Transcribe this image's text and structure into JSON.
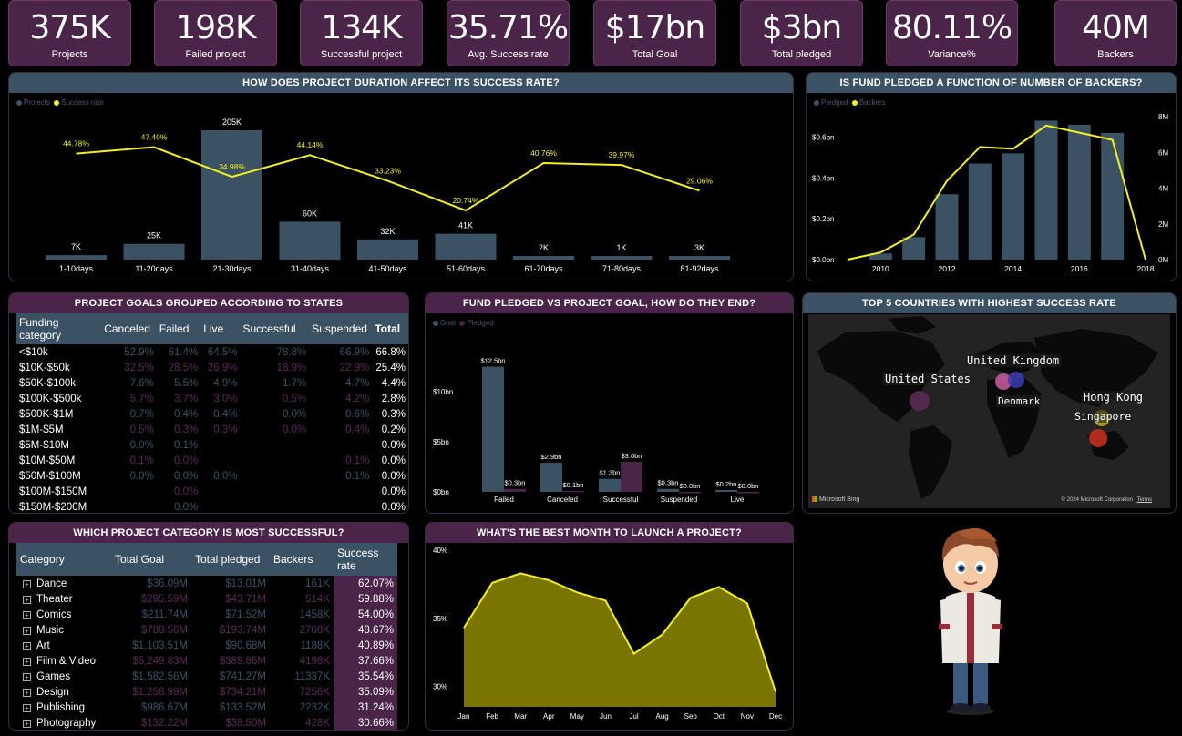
{
  "kpis": [
    {
      "value": "375K",
      "label": "Projects"
    },
    {
      "value": "198K",
      "label": "Failed project"
    },
    {
      "value": "134K",
      "label": "Successful project"
    },
    {
      "value": "35.71%",
      "label": "Avg. Success rate"
    },
    {
      "value": "$17bn",
      "label": "Total Goal"
    },
    {
      "value": "$3bn",
      "label": "Total pledged"
    },
    {
      "value": "80.11%",
      "label": "Variance%"
    },
    {
      "value": "40M",
      "label": "Backers"
    }
  ],
  "colors": {
    "bar": "#3b5265",
    "line": "#f2f01e",
    "panel_purple": "#4a2549",
    "accent_pink": "#c05a9a"
  },
  "duration": {
    "title": "HOW DOES PROJECT DURATION AFFECT ITS SUCCESS RATE?",
    "legend": [
      "Projects",
      "Success rate"
    ]
  },
  "pledged_backers": {
    "title": "IS FUND PLEDGED A FUNCTION OF NUMBER OF BACKERS?",
    "legend": [
      "Pledged",
      "Backers"
    ],
    "left_ticks": [
      "$0.0bn",
      "$0.2bn",
      "$0.4bn",
      "$0.6bn"
    ],
    "right_ticks": [
      "0M",
      "2M",
      "4M",
      "6M",
      "8M"
    ],
    "x_ticks": [
      "2010",
      "2012",
      "2014",
      "2016",
      "2018"
    ]
  },
  "goals_states": {
    "title": "PROJECT GOALS GROUPED ACCORDING TO STATES",
    "headers": [
      "Funding category",
      "Canceled",
      "Failed",
      "Live",
      "Successful",
      "Suspended",
      "Total"
    ],
    "rows": [
      [
        "<$10k",
        "52.9%",
        "61.4%",
        "64.5%",
        "78.8%",
        "66.9%",
        "66.8%"
      ],
      [
        "$10K-$50k",
        "32.5%",
        "28.5%",
        "26.9%",
        "18.9%",
        "22.9%",
        "25.4%"
      ],
      [
        "$50K-$100k",
        "7.6%",
        "5.5%",
        "4.9%",
        "1.7%",
        "4.7%",
        "4.4%"
      ],
      [
        "$100K-$500k",
        "5.7%",
        "3.7%",
        "3.0%",
        "0.5%",
        "4.2%",
        "2.8%"
      ],
      [
        "$500K-$1M",
        "0.7%",
        "0.4%",
        "0.4%",
        "0.0%",
        "0.6%",
        "0.3%"
      ],
      [
        "$1M-$5M",
        "0.5%",
        "0.3%",
        "0.3%",
        "0.0%",
        "0.4%",
        "0.2%"
      ],
      [
        "$5M-$10M",
        "0.0%",
        "0.1%",
        "",
        "",
        "",
        "0.0%"
      ],
      [
        "$10M-$50M",
        "0.1%",
        "0.0%",
        "",
        "",
        "0.1%",
        "0.0%"
      ],
      [
        "$50M-$100M",
        "0.0%",
        "0.0%",
        "0.0%",
        "",
        "0.1%",
        "0.0%"
      ],
      [
        "$100M-$150M",
        "",
        "0.0%",
        "",
        "",
        "",
        "0.0%"
      ],
      [
        "$150M-$200M",
        "",
        "0.0%",
        "",
        "",
        "",
        "0.0%"
      ]
    ]
  },
  "fund_vs_goal": {
    "title": "FUND PLEDGED VS PROJECT GOAL, HOW DO THEY END?",
    "legend": [
      "Goal",
      "Pledged"
    ],
    "y_ticks": [
      "$0bn",
      "$5bn",
      "$10bn"
    ]
  },
  "top_countries": {
    "title": "TOP 5 COUNTRIES WITH HIGHEST SUCCESS RATE",
    "labels": [
      "United Kingdom",
      "United States",
      "Denmark",
      "Hong Kong",
      "Singapore"
    ],
    "brand": "Microsoft Bing",
    "copyright": "© 2024 Microsoft Corporation",
    "terms": "Terms"
  },
  "category": {
    "title": "WHICH PROJECT CATEGORY IS MOST SUCCESSFUL?",
    "headers": [
      "Category",
      "Total Goal",
      "Total pledged",
      "Backers",
      "Success rate"
    ],
    "rows": [
      [
        "Dance",
        "$36.09M",
        "$13.01M",
        "161K",
        "62.07%"
      ],
      [
        "Theater",
        "$295.59M",
        "$43.71M",
        "514K",
        "59.88%"
      ],
      [
        "Comics",
        "$211.74M",
        "$71.52M",
        "1458K",
        "54.00%"
      ],
      [
        "Music",
        "$788.56M",
        "$193.74M",
        "2708K",
        "48.67%"
      ],
      [
        "Art",
        "$1,103.51M",
        "$90.68M",
        "1188K",
        "40.89%"
      ],
      [
        "Film & Video",
        "$5,249.83M",
        "$389.86M",
        "4198K",
        "37.66%"
      ],
      [
        "Games",
        "$1,582.56M",
        "$741.27M",
        "11337K",
        "35.54%"
      ],
      [
        "Design",
        "$1,258.99M",
        "$734.21M",
        "7256K",
        "35.09%"
      ],
      [
        "Publishing",
        "$986.67M",
        "$133.52M",
        "2232K",
        "31.24%"
      ],
      [
        "Photography",
        "$132.22M",
        "$38.50M",
        "428K",
        "30.66%"
      ]
    ]
  },
  "month": {
    "title": "WHAT'S THE BEST MONTH TO LAUNCH A PROJECT?",
    "y_ticks": [
      "30%",
      "35%",
      "40%"
    ]
  },
  "chart_data": [
    {
      "type": "bar",
      "title": "HOW DOES PROJECT DURATION AFFECT ITS SUCCESS RATE?",
      "categories": [
        "1-10days",
        "11-20days",
        "21-30days",
        "31-40days",
        "41-50days",
        "51-60days",
        "61-70days",
        "71-80days",
        "81-92days"
      ],
      "series": [
        {
          "name": "Projects",
          "values": [
            7000,
            25000,
            205000,
            60000,
            32000,
            41000,
            2000,
            1000,
            3000
          ],
          "labels": [
            "7K",
            "25K",
            "205K",
            "60K",
            "32K",
            "41K",
            "2K",
            "1K",
            "3K"
          ]
        },
        {
          "name": "Success rate",
          "values": [
            44.78,
            47.49,
            34.98,
            44.14,
            33.23,
            20.74,
            40.76,
            39.97,
            29.06
          ],
          "labels": [
            "44.78%",
            "47.49%",
            "34.98%",
            "44.14%",
            "33.23%",
            "20.74%",
            "40.76%",
            "39.97%",
            "29.06%"
          ]
        }
      ]
    },
    {
      "type": "bar",
      "title": "IS FUND PLEDGED A FUNCTION OF NUMBER OF BACKERS?",
      "x": [
        2009,
        2010,
        2011,
        2012,
        2013,
        2014,
        2015,
        2016,
        2017,
        2018
      ],
      "series": [
        {
          "name": "Pledged",
          "values": [
            0.0,
            0.03,
            0.11,
            0.32,
            0.47,
            0.52,
            0.68,
            0.66,
            0.62,
            0.0
          ]
        },
        {
          "name": "Backers",
          "values": [
            0.0,
            0.4,
            1.4,
            4.4,
            6.3,
            6.2,
            7.5,
            7.1,
            6.7,
            0.0
          ]
        }
      ],
      "ylim": [
        0,
        0.7
      ],
      "y2lim": [
        0,
        8
      ]
    },
    {
      "type": "bar",
      "title": "FUND PLEDGED VS PROJECT GOAL, HOW DO THEY END?",
      "categories": [
        "Failed",
        "Canceled",
        "Successful",
        "Suspended",
        "Live"
      ],
      "series": [
        {
          "name": "Goal",
          "values": [
            12.5,
            2.9,
            1.3,
            0.3,
            0.2
          ],
          "labels": [
            "$12.5bn",
            "$2.9bn",
            "$1.3bn",
            "$0.3bn",
            "$0.2bn"
          ]
        },
        {
          "name": "Pledged",
          "values": [
            0.3,
            0.1,
            3.0,
            0.0,
            0.0
          ],
          "labels": [
            "$0.3bn",
            "$0.1bn",
            "$3.0bn",
            "$0.0bn",
            "$0.0bn"
          ]
        }
      ],
      "ylim": [
        0,
        14
      ]
    },
    {
      "type": "area",
      "title": "WHAT'S THE BEST MONTH TO LAUNCH A PROJECT?",
      "categories": [
        "Jan",
        "Feb",
        "Mar",
        "Apr",
        "May",
        "Jun",
        "Jul",
        "Aug",
        "Sep",
        "Oct",
        "Nov",
        "Dec"
      ],
      "values": [
        34.3,
        37.6,
        38.3,
        37.8,
        36.9,
        36.3,
        32.4,
        33.8,
        36.5,
        37.3,
        36.1,
        29.6
      ],
      "ylim": [
        28.5,
        40
      ]
    }
  ]
}
